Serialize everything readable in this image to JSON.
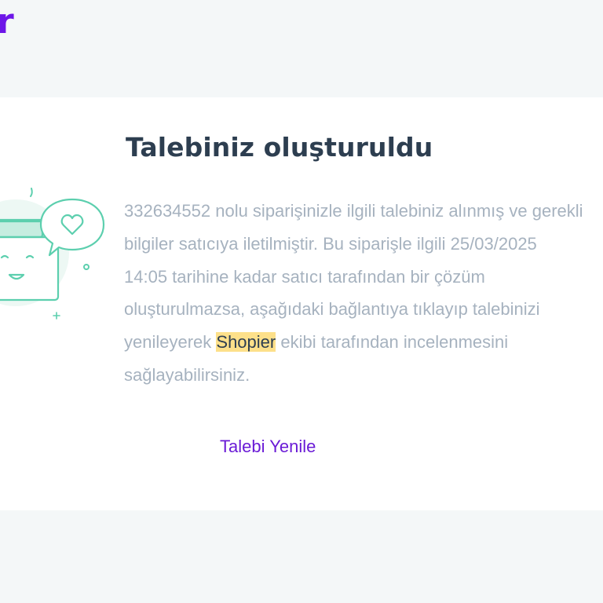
{
  "header": {
    "logo_text": "r"
  },
  "card": {
    "title": "Talebiniz oluşturuldu",
    "message_before": "332634552 nolu siparişinizle ilgili talebiniz alınmış ve gerekli bilgiler satıcıya iletilmiştir. Bu siparişle ilgili 25/03/2025 14:05 tarihine kadar satıcı tarafından bir çözüm oluşturulmazsa, aşağıdaki bağlantıya tıklayıp talebinizi yenileyerek ",
    "highlight_text": "Shopier",
    "message_after": " ekibi tarafından incelenmesini sağlayabilirsiniz.",
    "renew_link_label": "Talebi Yenile",
    "illustration_icon": "gift-box-heart-chat-icon"
  },
  "colors": {
    "brand": "#6d16e8",
    "title": "#2d3e50",
    "body_text": "#a6b2bf",
    "highlight": "#fde08a",
    "illustration_teal": "#5ccfae",
    "page_background": "#f4f7f8",
    "card_background": "#ffffff"
  }
}
